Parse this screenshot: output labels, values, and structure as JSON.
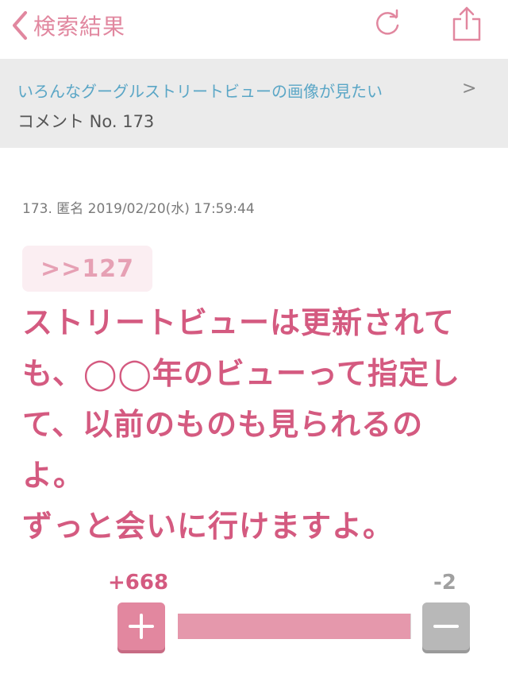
{
  "header": {
    "back_label": "検索結果"
  },
  "breadcrumb": {
    "topic": "いろんなグーグルストリートビューの画像が見たい",
    "separator": ">",
    "current": "コメント No. 173"
  },
  "comment": {
    "meta": "173. 匿名 2019/02/20(水) 17:59:44",
    "anchor": ">>127",
    "body": "ストリートビューは更新されて\nも、◯◯年のビューって指定し\nて、以前のものも見られるの\nよ。\nずっと会いに行けますよ。"
  },
  "votes": {
    "plus_label": "+668",
    "minus_label": "-2",
    "plus_fraction": 0.997
  },
  "colors": {
    "accent": "#d45a80",
    "accent_light": "#e2879f",
    "link": "#5aa6c6"
  }
}
